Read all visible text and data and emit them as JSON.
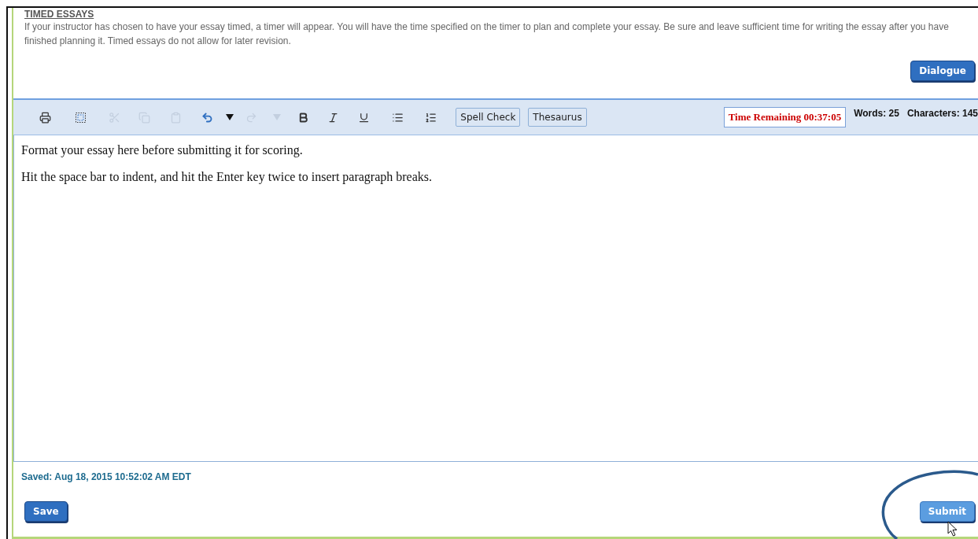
{
  "instructions": {
    "heading": "TIMED ESSAYS",
    "text": "If your instructor has chosen to have your essay timed, a timer will appear. You will have the time specified on the timer to plan and complete your essay. Be sure and leave sufficient time for writing the essay after you have finished planning it. Timed essays do not allow for later revision."
  },
  "dialogue_button": {
    "label": "Dialogue",
    "hovered": false
  },
  "toolbar": {
    "tools": [
      {
        "kind": "print",
        "disabled": false
      },
      {
        "kind": "select-all",
        "disabled": false
      },
      {
        "kind": "cut",
        "disabled": true
      },
      {
        "kind": "copy",
        "disabled": true
      },
      {
        "kind": "paste",
        "disabled": true
      },
      {
        "kind": "undo",
        "disabled": false
      },
      {
        "kind": "undo-menu",
        "disabled": false
      },
      {
        "kind": "redo",
        "disabled": true
      },
      {
        "kind": "redo-menu",
        "disabled": true
      },
      {
        "kind": "bold",
        "disabled": false
      },
      {
        "kind": "italic",
        "disabled": false
      },
      {
        "kind": "underline",
        "disabled": false
      },
      {
        "kind": "bullets",
        "disabled": false
      },
      {
        "kind": "numbering",
        "disabled": false
      }
    ],
    "buttons": [
      "Spell Check",
      "Thesaurus"
    ],
    "timer": "Time Remaining 00:37:05",
    "words": "Words: 25",
    "characters": "Characters: 145"
  },
  "editor": {
    "paragraphs": [
      "Format your essay here before submitting it for scoring.",
      "Hit the space bar to indent, and hit the Enter key twice to insert paragraph breaks."
    ]
  },
  "saved": "Saved: Aug 18, 2015 10:52:02 AM EDT",
  "save_button": {
    "label": "Save",
    "hovered": false
  },
  "submit_button": {
    "label": "Submit",
    "hovered": true
  }
}
